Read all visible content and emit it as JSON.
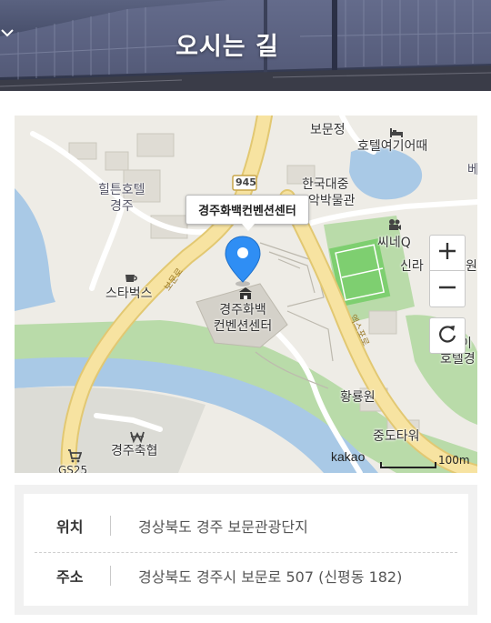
{
  "header": {
    "title": "오시는 길",
    "chevron_icon": "chevron-down-icon"
  },
  "map": {
    "callout": "경주화백컨벤션센터",
    "venue_label_line1": "경주화백",
    "venue_label_line2": "컨벤션센터",
    "road_sign": "945",
    "road_name_left": "보문로",
    "road_name_right": "엑스포로",
    "labels": {
      "bomunjeong": "보문정",
      "hotel_yeogi": "호텔여기어때",
      "hilton_line1": "힐튼호텔",
      "hilton_line2": "경주",
      "korea_museum_line1": "한국대중",
      "korea_museum_line2": "악박물관",
      "cineq": "씨네Q",
      "shilla": "신라",
      "shilla_suffix": "원",
      "starbucks": "스타벅스",
      "hwangryong": "황룡원",
      "jungdo_tower": "중도타워",
      "gyeongju_coop": "경주축협",
      "gs25": "GS25",
      "edge_be": "베",
      "edge_hotel_top": "이",
      "edge_hotel": "호텔경"
    },
    "controls": {
      "zoom_in": "+",
      "zoom_out": "−",
      "reset_icon": "refresh-icon"
    },
    "brand": "kakao",
    "scale": "100m",
    "colors": {
      "marker": "#2f8ef4",
      "road": "#f7e3a1",
      "water": "#a9c9e6",
      "green": "#b9dba9"
    }
  },
  "info": {
    "location_label": "위치",
    "location_value": "경상북도 경주 보문관광단지",
    "address_label": "주소",
    "address_value": "경상북도 경주시 보문로 507 (신평동 182)"
  }
}
